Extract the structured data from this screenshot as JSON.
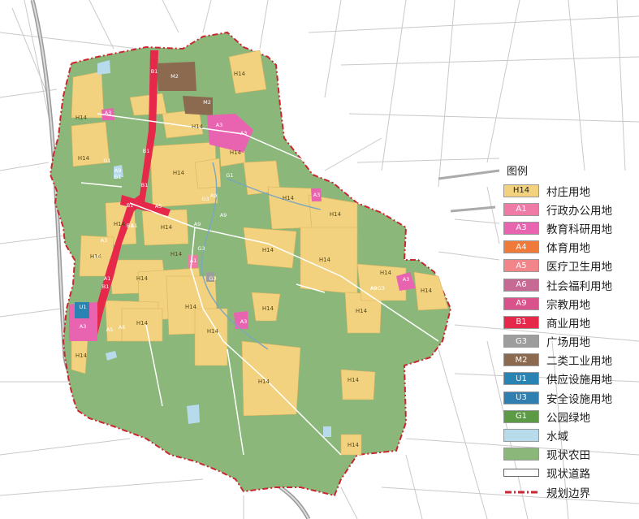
{
  "legend": {
    "title": "图例",
    "items": [
      {
        "code": "H14",
        "label": "村庄用地",
        "color": "#f2d27f",
        "text_color": "#222222"
      },
      {
        "code": "A1",
        "label": "行政办公用地",
        "color": "#f07aa6",
        "text_color": "#ffffff"
      },
      {
        "code": "A3",
        "label": "教育科研用地",
        "color": "#e964b0",
        "text_color": "#ffffff"
      },
      {
        "code": "A4",
        "label": "体育用地",
        "color": "#f07a3a",
        "text_color": "#ffffff"
      },
      {
        "code": "A5",
        "label": "医疗卫生用地",
        "color": "#f2858a",
        "text_color": "#ffffff"
      },
      {
        "code": "A6",
        "label": "社会福利用地",
        "color": "#c76a93",
        "text_color": "#ffffff"
      },
      {
        "code": "A9",
        "label": "宗教用地",
        "color": "#d9528b",
        "text_color": "#ffffff"
      },
      {
        "code": "B1",
        "label": "商业用地",
        "color": "#e6284a",
        "text_color": "#ffffff"
      },
      {
        "code": "G3",
        "label": "广场用地",
        "color": "#9d9d9d",
        "text_color": "#ffffff"
      },
      {
        "code": "M2",
        "label": "二类工业用地",
        "color": "#8c6a4f",
        "text_color": "#ffffff"
      },
      {
        "code": "U1",
        "label": "供应设施用地",
        "color": "#2a84b3",
        "text_color": "#ffffff"
      },
      {
        "code": "U3",
        "label": "安全设施用地",
        "color": "#2f7fb0",
        "text_color": "#ffffff"
      },
      {
        "code": "G1",
        "label": "公园绿地",
        "color": "#5d9a45",
        "text_color": "#ffffff"
      },
      {
        "code": "",
        "label": "水域",
        "color": "#b7dbea",
        "text_color": "#222222"
      },
      {
        "code": "",
        "label": "现状农田",
        "color": "#8bb77a",
        "text_color": "#222222"
      },
      {
        "code": "",
        "label": "现状道路",
        "color": "#ffffff",
        "text_color": "#222222"
      },
      {
        "code": "",
        "label": "规划边界",
        "color": "#ffffff",
        "text_color": "#222222"
      }
    ]
  },
  "map_labels": [
    {
      "text": "H14",
      "type": "H14"
    },
    {
      "text": "H14",
      "type": "H14"
    },
    {
      "text": "H14",
      "type": "H14"
    },
    {
      "text": "H14",
      "type": "H14"
    },
    {
      "text": "H14",
      "type": "H14"
    },
    {
      "text": "H14",
      "type": "H14"
    },
    {
      "text": "H14",
      "type": "H14"
    },
    {
      "text": "H14",
      "type": "H14"
    },
    {
      "text": "H14",
      "type": "H14"
    },
    {
      "text": "H14",
      "type": "H14"
    },
    {
      "text": "H14",
      "type": "H14"
    },
    {
      "text": "H14",
      "type": "H14"
    },
    {
      "text": "H14",
      "type": "H14"
    },
    {
      "text": "H14",
      "type": "H14"
    },
    {
      "text": "H14",
      "type": "H14"
    },
    {
      "text": "H14",
      "type": "H14"
    },
    {
      "text": "H14",
      "type": "H14"
    },
    {
      "text": "H14",
      "type": "H14"
    },
    {
      "text": "H14",
      "type": "H14"
    },
    {
      "text": "H14",
      "type": "H14"
    },
    {
      "text": "H14",
      "type": "H14"
    },
    {
      "text": "H14",
      "type": "H14"
    },
    {
      "text": "H14",
      "type": "H14"
    },
    {
      "text": "H14",
      "type": "H14"
    },
    {
      "text": "H14",
      "type": "H14"
    },
    {
      "text": "H14",
      "type": "H14"
    },
    {
      "text": "M2",
      "type": "M2"
    },
    {
      "text": "M2",
      "type": "M2"
    },
    {
      "text": "A3",
      "type": "A3"
    },
    {
      "text": "A3",
      "type": "A3"
    },
    {
      "text": "A3",
      "type": "A3"
    },
    {
      "text": "A3",
      "type": "A3"
    },
    {
      "text": "A3",
      "type": "A3"
    },
    {
      "text": "A3",
      "type": "A3"
    },
    {
      "text": "A3",
      "type": "A3"
    },
    {
      "text": "A3",
      "type": "A3"
    },
    {
      "text": "A1",
      "type": "A1"
    },
    {
      "text": "A1",
      "type": "A1"
    },
    {
      "text": "A1",
      "type": "A1"
    },
    {
      "text": "A5",
      "type": "A5"
    },
    {
      "text": "A5",
      "type": "A5"
    },
    {
      "text": "A6",
      "type": "A6"
    },
    {
      "text": "A9",
      "type": "A9"
    },
    {
      "text": "A9",
      "type": "A9"
    },
    {
      "text": "A9",
      "type": "A9"
    },
    {
      "text": "A9",
      "type": "A9"
    },
    {
      "text": "A9",
      "type": "A9"
    },
    {
      "text": "B1",
      "type": "B1"
    },
    {
      "text": "B1",
      "type": "B1"
    },
    {
      "text": "B1",
      "type": "B1"
    },
    {
      "text": "B1",
      "type": "B1"
    },
    {
      "text": "B1",
      "type": "B1"
    },
    {
      "text": "B1",
      "type": "B1"
    },
    {
      "text": "G1",
      "type": "G1"
    },
    {
      "text": "G1",
      "type": "G1"
    },
    {
      "text": "G1",
      "type": "G1"
    },
    {
      "text": "G3",
      "type": "G3"
    },
    {
      "text": "G3",
      "type": "G3"
    },
    {
      "text": "G3",
      "type": "G3"
    },
    {
      "text": "U1",
      "type": "U1"
    },
    {
      "text": "U3",
      "type": "U3"
    },
    {
      "text": "A9G3",
      "type": "A9"
    }
  ]
}
